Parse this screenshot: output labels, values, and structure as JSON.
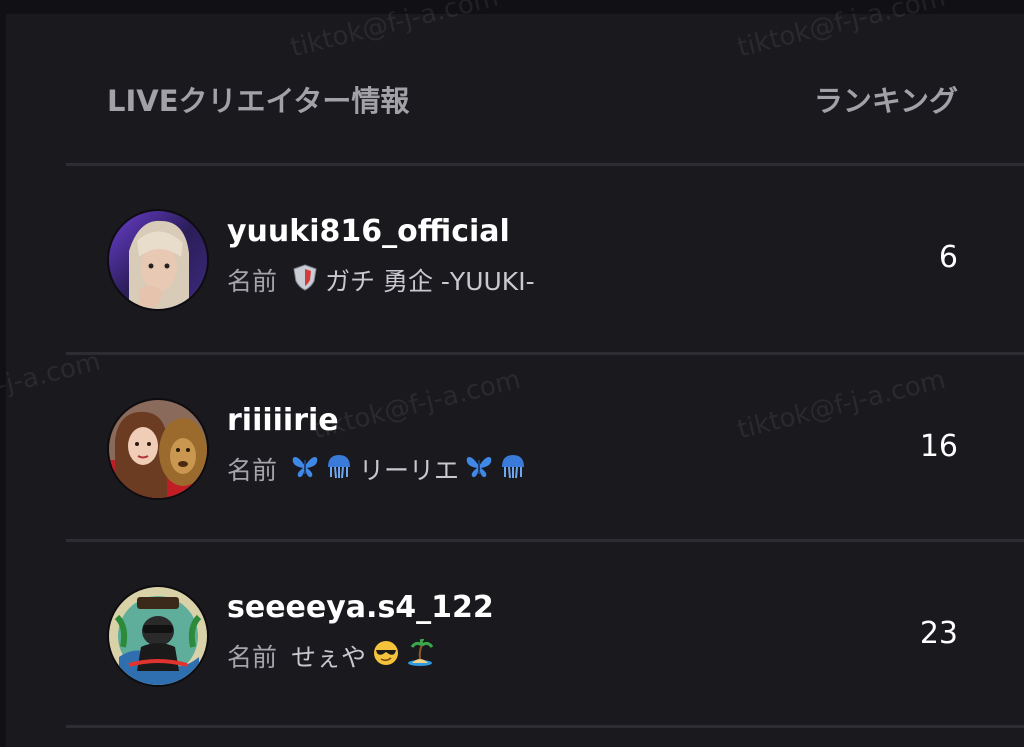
{
  "header": {
    "title": "LIVEクリエイター情報",
    "rank_label": "ランキング"
  },
  "name_label": "名前",
  "watermark": "tiktok@f-j-a.com",
  "creators": [
    {
      "username": "yuuki816_official",
      "display_before": "",
      "display_name": "ガチ 勇企 -YUUKI-",
      "emojis_before": [
        "shield"
      ],
      "emojis_after": [],
      "rank": "6"
    },
    {
      "username": "riiiiirie",
      "display_name": "リーリエ",
      "emojis_before": [
        "butterfly",
        "jellyfish"
      ],
      "emojis_after": [
        "butterfly",
        "jellyfish"
      ],
      "rank": "16"
    },
    {
      "username": "seeeeya.s4_122",
      "display_name": "せぇや",
      "emojis_before": [],
      "emojis_after": [
        "sunglasses-face",
        "island"
      ],
      "rank": "23"
    }
  ],
  "colors": {
    "background": "#1a191e",
    "divider": "#2d2c32",
    "header_text": "#a2a1a8",
    "username": "#ffffff"
  }
}
